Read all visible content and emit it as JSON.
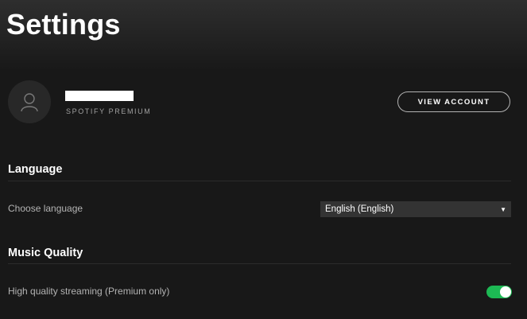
{
  "header": {
    "title": "Settings"
  },
  "profile": {
    "plan": "SPOTIFY PREMIUM",
    "view_account_label": "VIEW ACCOUNT",
    "avatar_icon": "user-icon"
  },
  "language": {
    "heading": "Language",
    "choose_label": "Choose language",
    "selected": "English (English)",
    "dropdown_icon": "triangle-down-icon"
  },
  "music_quality": {
    "heading": "Music Quality",
    "streaming_label": "High quality streaming (Premium only)",
    "streaming_enabled": true
  },
  "colors": {
    "background": "#181818",
    "accent": "#1db954",
    "muted_text": "#b3b3b3"
  }
}
